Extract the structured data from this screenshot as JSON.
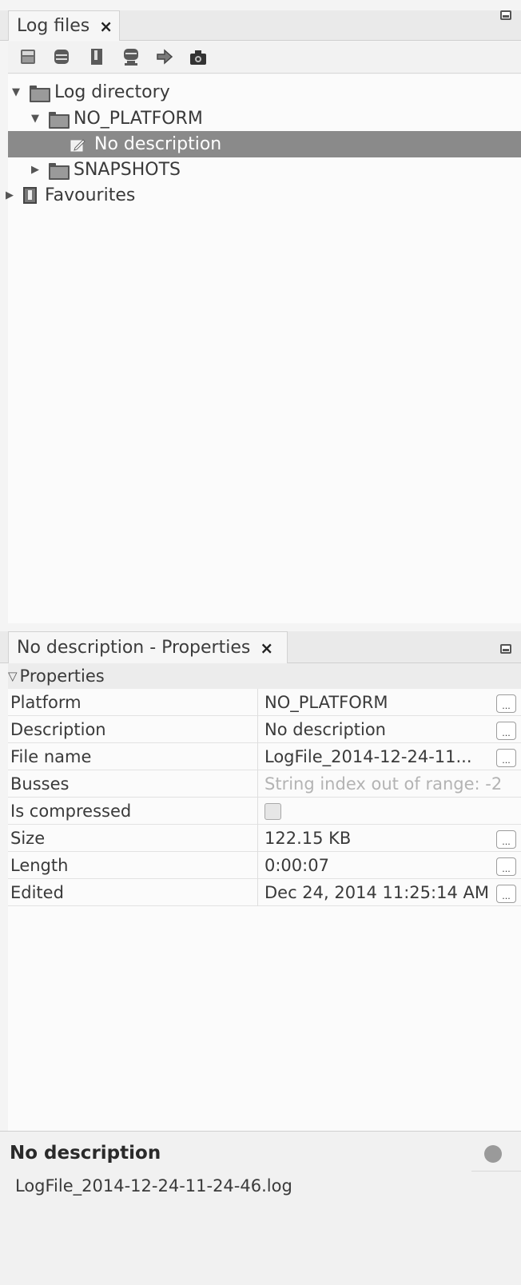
{
  "logfiles_panel": {
    "tab_label": "Log files",
    "close_glyph": "×",
    "toolbar_icons": [
      "folder-open-icon",
      "database-icon",
      "bookmark-icon",
      "database-export-icon",
      "arrow-right-icon",
      "camera-icon"
    ],
    "tree": [
      {
        "label": "Log directory",
        "expanded": true,
        "icon": "folder-icon"
      },
      {
        "label": "NO_PLATFORM",
        "expanded": true,
        "icon": "folder-icon"
      },
      {
        "label": "No description",
        "selected": true,
        "icon": "edit-icon"
      },
      {
        "label": "SNAPSHOTS",
        "expanded": false,
        "icon": "folder-icon"
      },
      {
        "label": "Favourites",
        "expanded": false,
        "icon": "bookmark-icon"
      }
    ]
  },
  "properties_panel": {
    "tab_label": "No description - Properties",
    "close_glyph": "×",
    "section_label": "Properties",
    "rows": [
      {
        "name": "Platform",
        "value": "NO_PLATFORM"
      },
      {
        "name": "Description",
        "value": "No description"
      },
      {
        "name": "File name",
        "value": "LogFile_2014-12-24-11..."
      },
      {
        "name": "Busses",
        "value": "String index out of range: -2"
      },
      {
        "name": "Is compressed",
        "value": ""
      },
      {
        "name": "Size",
        "value": "122.15 KB"
      },
      {
        "name": "Length",
        "value": "0:00:07"
      },
      {
        "name": "Edited",
        "value": "Dec 24, 2014 11:25:14 AM"
      }
    ],
    "ellipsis_label": "..."
  },
  "description": {
    "title": "No description",
    "text": "LogFile_2014-12-24-11-24-46.log"
  }
}
